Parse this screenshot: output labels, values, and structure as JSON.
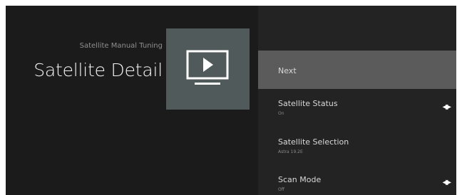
{
  "header": {
    "breadcrumb": "Satellite Manual Tuning",
    "title": "Satellite Detail"
  },
  "tile": {
    "icon": "tv-play-icon"
  },
  "menu": {
    "items": [
      {
        "label": "Next",
        "value": "",
        "has_arrows": false,
        "focused": true
      },
      {
        "label": "Satellite Status",
        "value": "On",
        "has_arrows": true,
        "focused": false
      },
      {
        "label": "Satellite Selection",
        "value": "Astra 19.2E",
        "has_arrows": false,
        "focused": false
      },
      {
        "label": "Scan Mode",
        "value": "Off",
        "has_arrows": true,
        "focused": false
      }
    ]
  },
  "icons": {
    "arrows": "left-right-arrows-icon"
  },
  "colors": {
    "background": "#1b1b1b",
    "panel": "#232323",
    "focus": "#5b5b5b",
    "tile": "#505a5a"
  }
}
